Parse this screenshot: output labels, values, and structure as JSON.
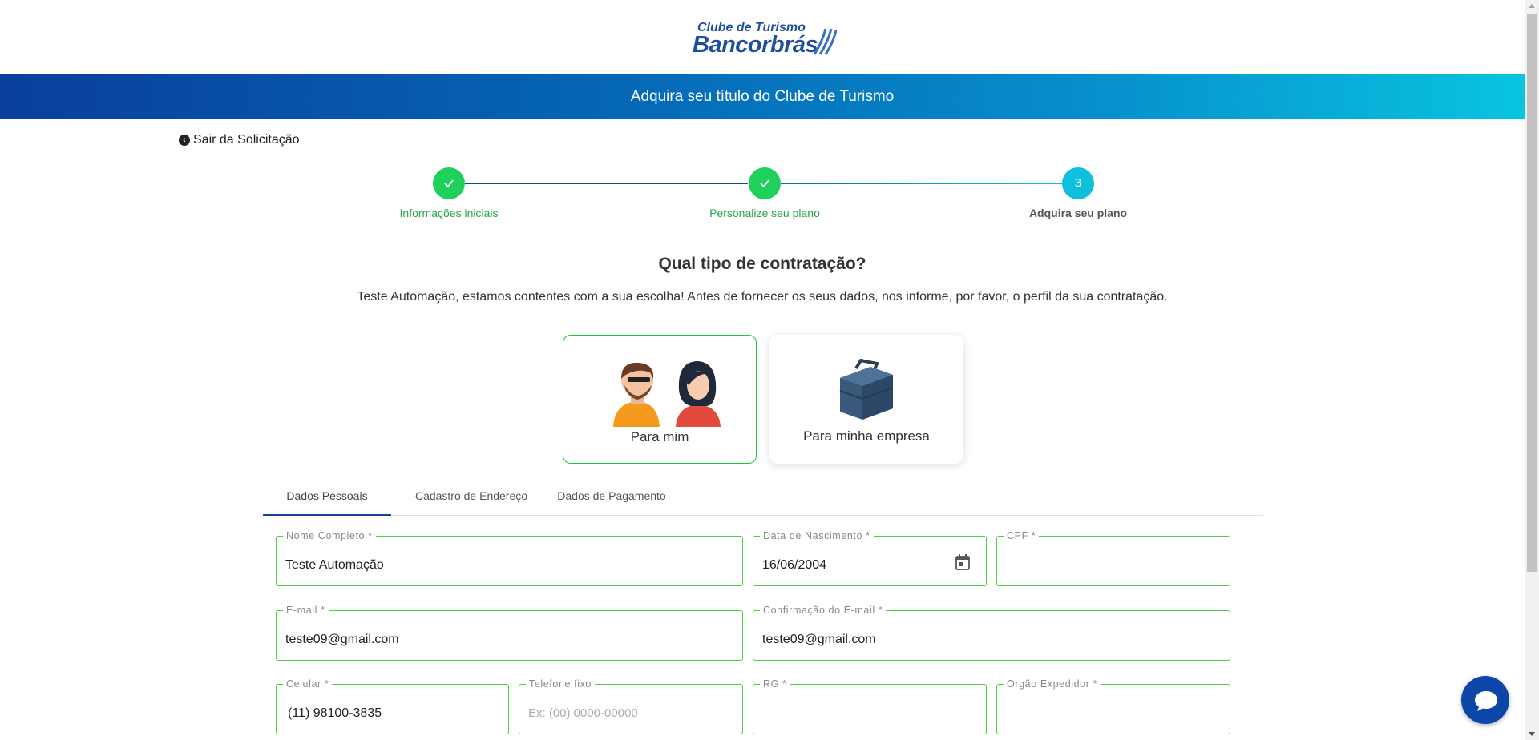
{
  "brand": {
    "line1": "Clube de Turismo",
    "line2": "Bancorbrás"
  },
  "banner": {
    "title": "Adquira seu título do Clube de Turismo"
  },
  "exit": {
    "label": "Sair da Solicitação",
    "icon": "chevron-left-circle-icon"
  },
  "stepper": {
    "steps": [
      {
        "number": "1",
        "label": "Informações iniciais",
        "status": "completed"
      },
      {
        "number": "2",
        "label": "Personalize seu plano",
        "status": "completed"
      },
      {
        "number": "3",
        "label": "Adquira seu plano",
        "status": "active"
      }
    ],
    "completed_color": "#1fd05a",
    "active_color": "#0fc0dc"
  },
  "question": {
    "title": "Qual tipo de contratação?",
    "subtitle": "Teste Automação, estamos contentes com a sua escolha! Antes de fornecer os seus dados, nos informe, por favor, o perfil da sua contratação."
  },
  "choices": [
    {
      "label": "Para mim",
      "icon": "people-icon",
      "selected": true
    },
    {
      "label": "Para minha empresa",
      "icon": "briefcase-icon",
      "selected": false
    }
  ],
  "tabs": [
    {
      "label": "Dados Pessoais",
      "active": true
    },
    {
      "label": "Cadastro de Endereço",
      "active": false
    },
    {
      "label": "Dados de Pagamento",
      "active": false
    }
  ],
  "form": {
    "nome": {
      "label": "Nome Completo *",
      "value": "Teste Automação"
    },
    "nascimento": {
      "label": "Data de Nascimento *",
      "value": "16/06/2004"
    },
    "cpf": {
      "label": "CPF *",
      "value": ""
    },
    "email": {
      "label": "E-mail *",
      "value": "teste09@gmail.com"
    },
    "email_conf": {
      "label": "Confirmação do E-mail *",
      "value": "teste09@gmail.com"
    },
    "celular": {
      "label": "Celular *",
      "value": "(11) 98100-3835"
    },
    "telefone": {
      "label": "Telefone fixo",
      "placeholder": "Ex: (00) 0000-00000"
    },
    "rg": {
      "label": "RG *",
      "value": ""
    },
    "orgao": {
      "label": "Orgão Expedidor *",
      "value": ""
    }
  },
  "chat": {
    "icon": "chat-bubble-icon"
  },
  "colors": {
    "field_border": "#4cd03b",
    "tab_underline": "#1a3f9c",
    "brand_blue": "#1f4e9c"
  }
}
